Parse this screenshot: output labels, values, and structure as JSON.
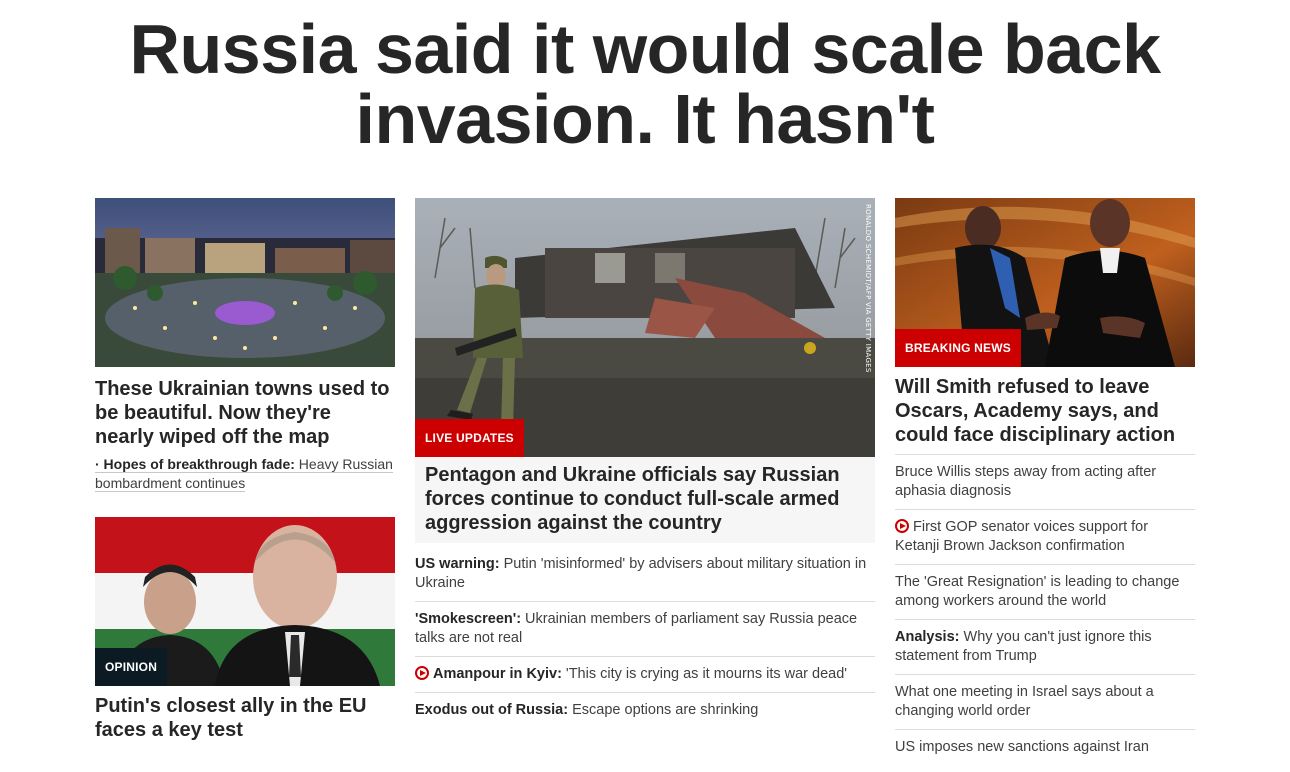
{
  "main_headline": "Russia said it would scale back invasion. It hasn't",
  "left": {
    "story1": {
      "title": "These Ukrainian towns used to be beautiful. Now they're nearly wiped off the map",
      "sub_bold": "· Hopes of breakthrough fade:",
      "sub_text": " Heavy Russian bombardment continues"
    },
    "story2": {
      "tag": "OPINION",
      "title": "Putin's closest ally in the EU faces a key test"
    }
  },
  "middle": {
    "tag": "LIVE UPDATES",
    "credit": "RONALDO SCHEMIDT/AFP VIA GETTY IMAGES",
    "title": "Pentagon and Ukraine officials say Russian forces continue to conduct full-scale armed aggression against the country",
    "items": [
      {
        "bold": "US warning:",
        "text": " Putin 'misinformed' by advisers about military situation in Ukraine",
        "video": false
      },
      {
        "bold": "'Smokescreen':",
        "text": " Ukrainian members of parliament say Russia peace talks are not real",
        "video": false
      },
      {
        "bold": "Amanpour in Kyiv:",
        "text": " 'This city is crying as it mourns its war dead'",
        "video": true
      },
      {
        "bold": "Exodus out of Russia:",
        "text": " Escape options are shrinking",
        "video": false
      }
    ]
  },
  "right": {
    "tag": "BREAKING NEWS",
    "title": "Will Smith refused to leave Oscars, Academy says, and could face disciplinary action",
    "items": [
      {
        "bold": "",
        "text": "Bruce Willis steps away from acting after aphasia diagnosis",
        "video": false
      },
      {
        "bold": "",
        "text": "First GOP senator voices support for Ketanji Brown Jackson confirmation",
        "video": true
      },
      {
        "bold": "",
        "text": "The 'Great Resignation' is leading to change among workers around the world",
        "video": false
      },
      {
        "bold": "Analysis:",
        "text": " Why you can't just ignore this statement from Trump",
        "video": false
      },
      {
        "bold": "",
        "text": "What one meeting in Israel says about a changing world order",
        "video": false
      },
      {
        "bold": "",
        "text": "US imposes new sanctions against Iran",
        "video": false
      }
    ]
  },
  "colors": {
    "accent_red": "#cc0000",
    "opinion_dark": "#0c1a24",
    "text": "#262626"
  }
}
